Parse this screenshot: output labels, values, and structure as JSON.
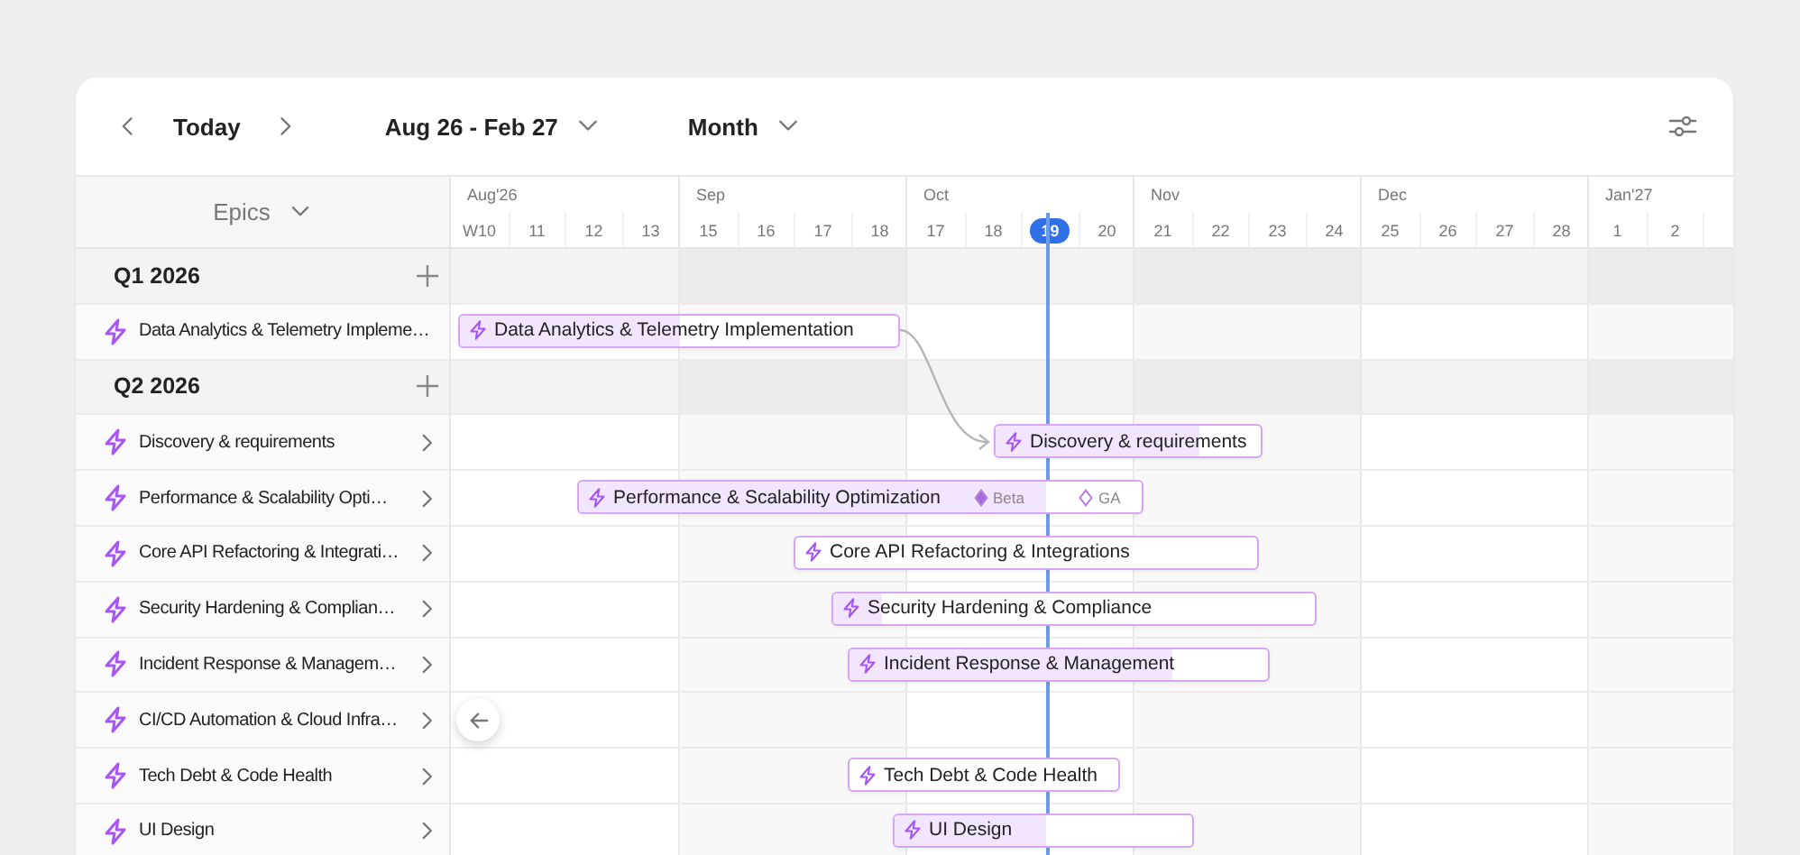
{
  "toolbar": {
    "today_button": "Today",
    "range": "Aug 26 - Feb 27",
    "view": "Month"
  },
  "sidebar_header": "Epics",
  "months": [
    {
      "label": "Aug'26",
      "weeks": [
        {
          "label": "W10",
          "selected": false
        },
        {
          "label": "11",
          "selected": false
        },
        {
          "label": "12",
          "selected": false
        },
        {
          "label": "13",
          "selected": false
        }
      ]
    },
    {
      "label": "Sep",
      "weeks": [
        {
          "label": "15",
          "selected": false
        },
        {
          "label": "16",
          "selected": false
        },
        {
          "label": "17",
          "selected": false
        },
        {
          "label": "18",
          "selected": false
        }
      ]
    },
    {
      "label": "Oct",
      "weeks": [
        {
          "label": "17",
          "selected": false
        },
        {
          "label": "18",
          "selected": false
        },
        {
          "label": "19",
          "selected": true
        },
        {
          "label": "20",
          "selected": false
        }
      ]
    },
    {
      "label": "Nov",
      "weeks": [
        {
          "label": "21",
          "selected": false
        },
        {
          "label": "22",
          "selected": false
        },
        {
          "label": "23",
          "selected": false
        },
        {
          "label": "24",
          "selected": false
        }
      ]
    },
    {
      "label": "Dec",
      "weeks": [
        {
          "label": "25",
          "selected": false
        },
        {
          "label": "26",
          "selected": false
        },
        {
          "label": "27",
          "selected": false
        },
        {
          "label": "28",
          "selected": false
        }
      ]
    },
    {
      "label": "Jan'27",
      "weeks": [
        {
          "label": "1",
          "selected": false
        },
        {
          "label": "2",
          "selected": false
        },
        {
          "selected": false
        }
      ]
    }
  ],
  "rows": [
    {
      "kind": "group",
      "label": "Q1 2026"
    },
    {
      "kind": "epic",
      "name": "Data Analytics & Telemetry Impleme…",
      "expandable": false,
      "bar": {
        "label": "Data Analytics & Telemetry Implementation",
        "level": 0.5
      }
    },
    {
      "kind": "group",
      "label": "Q2 2026"
    },
    {
      "kind": "epic",
      "name": "Discovery & requirements",
      "expandable": true,
      "bar": {
        "label": "Discovery & requirements",
        "level": 0.77
      }
    },
    {
      "kind": "epic",
      "name": "Performance & Scalability Opti…",
      "expandable": true,
      "bar": {
        "label": "Performance & Scalability Optimization",
        "level": 0.83,
        "milestones": [
          {
            "label": "Beta",
            "done": true
          },
          {
            "label": "GA",
            "done": false
          }
        ]
      }
    },
    {
      "kind": "epic",
      "name": "Core API Refactoring & Integrati…",
      "expandable": true,
      "bar": {
        "label": "Core API Refactoring & Integrations",
        "level": 0
      }
    },
    {
      "kind": "epic",
      "name": "Security Hardening & Complian…",
      "expandable": true,
      "bar": {
        "label": "Security Hardening & Compliance",
        "level": 0.1
      }
    },
    {
      "kind": "epic",
      "name": "Incident Response & Managem…",
      "expandable": true,
      "bar": {
        "label": "Incident Response & Management",
        "level": 0.77
      }
    },
    {
      "kind": "epic",
      "name": "CI/CD Automation & Cloud Infra…",
      "expandable": true
    },
    {
      "kind": "epic",
      "name": "Tech Debt & Code Health",
      "expandable": true,
      "bar": {
        "label": "Tech Debt & Code Health",
        "level": 0
      }
    },
    {
      "kind": "epic",
      "name": "UI Design",
      "expandable": true,
      "bar": {
        "label": "UI Design",
        "level": 0.51
      }
    }
  ]
}
